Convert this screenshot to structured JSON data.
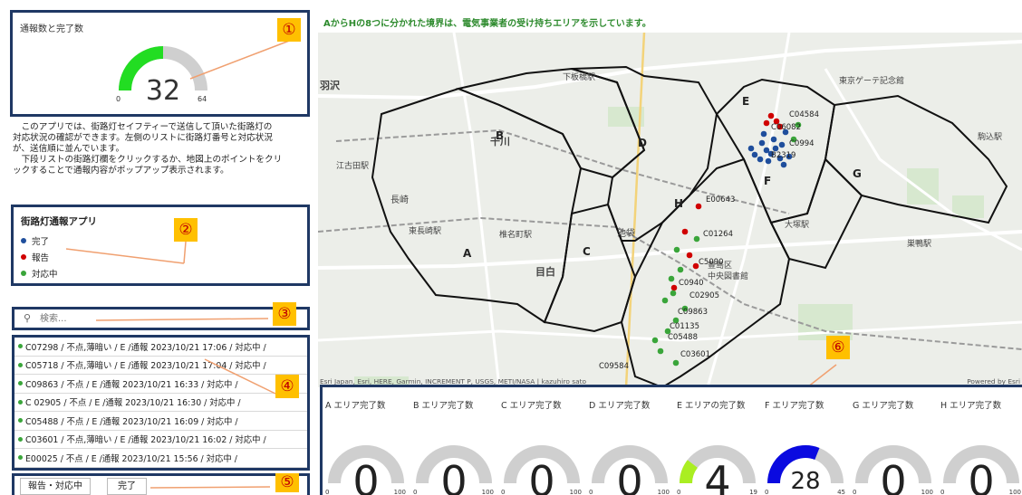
{
  "gauge_main": {
    "title": "通報数と完了数",
    "value": "32",
    "min": "0",
    "max": "64",
    "fraction": 0.5,
    "fill_color": "#22dd22",
    "track_color": "#cfcfcf"
  },
  "callouts": [
    "①",
    "②",
    "③",
    "④",
    "⑤",
    "⑥"
  ],
  "description": {
    "line1": "　このアプリでは、街路灯セイフティーで送信して頂いた街路灯の",
    "line2": "対応状況の確認ができます。左側のリストに街路灯番号と対応状況",
    "line3": "が、送信順に並んでいます。",
    "line4": "　下段リストの街路灯欄をクリックするか、地図上のポイントをクリ",
    "line5": "ックすることで通報内容がポップアップ表示されます。"
  },
  "legend": {
    "title": "街路灯通報アプリ",
    "items": [
      {
        "label": "完了",
        "color": "#1f4e9c"
      },
      {
        "label": "報告",
        "color": "#d00000"
      },
      {
        "label": "対応中",
        "color": "#3aa53a"
      }
    ]
  },
  "search": {
    "placeholder": "検索...",
    "icon": "search-icon"
  },
  "list": [
    "C07298 / 不点,薄暗い / E /通報 2023/10/21 17:06 / 対応中 /",
    "C05718 / 不点,薄暗い / E /通報 2023/10/21 17:04 / 対応中 /",
    "C09863 / 不点 / E /通報 2023/10/21 16:33 / 対応中 /",
    "C 02905 / 不点 / E /通報 2023/10/21 16:30 / 対応中 /",
    "C05488 / 不点 / E /通報 2023/10/21 16:09 / 対応中 /",
    "C03601 / 不点,薄暗い / E /通報 2023/10/21 16:02 / 対応中 /",
    "E00025 / 不点 / E /通報 2023/10/21 15:56 / 対応中 /"
  ],
  "buttons": {
    "report": "報告・対応中",
    "done": "完了"
  },
  "map": {
    "title": "AからHの8つに分かれた境界は、電気事業者の受け持ちエリアを示しています。",
    "attribution": "Esri Japan, Esri, HERE, Garmin, INCREMENT P, USGS, METI/NASA | kazuhiro sato",
    "powered": "Powered by Esri",
    "area_labels": [
      "A",
      "B",
      "C",
      "D",
      "E",
      "F",
      "G",
      "H"
    ],
    "place_labels": [
      "千川",
      "池袋",
      "目白",
      "長崎",
      "東長崎駅",
      "椎名町駅",
      "駒込駅",
      "下板橋駅",
      "大塚駅",
      "東京ゲーテ記念館",
      "羽沢",
      "江古田駅",
      "豊島区",
      "中央図書館",
      "巣鴨駅"
    ],
    "point_labels": [
      "C04584",
      "C06082",
      "C0994",
      "B2319",
      "E00643",
      "C01264",
      "C5090",
      "C0940",
      "C02905",
      "C09863",
      "C01135",
      "C05488",
      "C03601",
      "C09584"
    ]
  },
  "area_gauges": [
    {
      "title": "A エリア完了数",
      "value": "0",
      "min": "0",
      "max": "100",
      "fraction": 0,
      "fill_color": "#22dd22"
    },
    {
      "title": "B エリア完了数",
      "value": "0",
      "min": "0",
      "max": "100",
      "fraction": 0,
      "fill_color": "#22dd22"
    },
    {
      "title": "C エリア完了数",
      "value": "0",
      "min": "0",
      "max": "100",
      "fraction": 0,
      "fill_color": "#22dd22"
    },
    {
      "title": "D エリア完了数",
      "value": "0",
      "min": "0",
      "max": "100",
      "fraction": 0,
      "fill_color": "#22dd22"
    },
    {
      "title": "E エリアの完了数",
      "value": "4",
      "min": "0",
      "max": "19",
      "fraction": 0.21,
      "fill_color": "#aaee22"
    },
    {
      "title": "F エリア完了数",
      "value": "28",
      "min": "0",
      "max": "45",
      "fraction": 0.62,
      "fill_color": "#0a0ae0"
    },
    {
      "title": "G エリア完了数",
      "value": "0",
      "min": "0",
      "max": "100",
      "fraction": 0,
      "fill_color": "#22dd22"
    },
    {
      "title": "H エリア完了数",
      "value": "0",
      "min": "0",
      "max": "100",
      "fraction": 0,
      "fill_color": "#22dd22"
    }
  ]
}
